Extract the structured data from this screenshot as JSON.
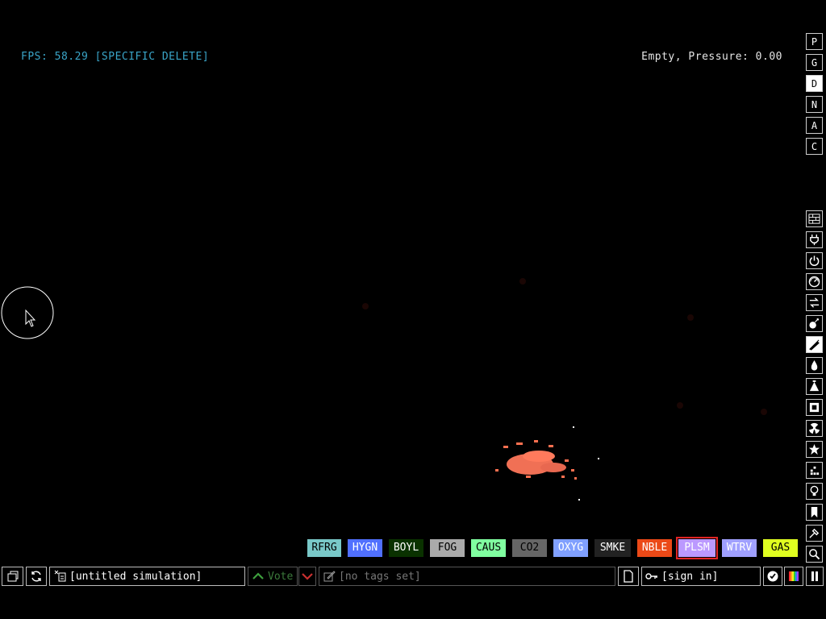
{
  "hud": {
    "fps_text": "FPS: 58.29 [SPECIFIC DELETE]",
    "pressure_text": "Empty, Pressure: 0.00"
  },
  "menu_letters": [
    "P",
    "G",
    "D",
    "N",
    "A",
    "C"
  ],
  "active_menu_letter": "D",
  "category_icons": [
    "walls-icon",
    "electronics-icon",
    "powered-icon",
    "sensors-icon",
    "force-icon",
    "explosives-icon",
    "gases-icon",
    "liquids-icon",
    "powders-icon",
    "solids-icon",
    "radioactive-icon",
    "special-icon",
    "life-icon",
    "tools-icon",
    "favorites-icon",
    "decoration-icon",
    "search-icon"
  ],
  "elements": [
    {
      "label": "RFRG",
      "bg": "#79c8c8",
      "fg": "#000000"
    },
    {
      "label": "HYGN",
      "bg": "#5070ff",
      "fg": "#ffffff"
    },
    {
      "label": "BOYL",
      "bg": "#0a3200",
      "fg": "#ffffff"
    },
    {
      "label": "FOG",
      "bg": "#aaaaaa",
      "fg": "#000000"
    },
    {
      "label": "CAUS",
      "bg": "#80ffa0",
      "fg": "#000000"
    },
    {
      "label": "CO2",
      "bg": "#666666",
      "fg": "#000000"
    },
    {
      "label": "OXYG",
      "bg": "#80a0ff",
      "fg": "#ffffff"
    },
    {
      "label": "SMKE",
      "bg": "#222222",
      "fg": "#ffffff"
    },
    {
      "label": "NBLE",
      "bg": "#eb4917",
      "fg": "#ffffff"
    },
    {
      "label": "PLSM",
      "bg": "#bb99ff",
      "fg": "#ffffff"
    },
    {
      "label": "WTRV",
      "bg": "#a0a0ff",
      "fg": "#ffffff"
    },
    {
      "label": "GAS",
      "bg": "#e0ff20",
      "fg": "#000000"
    }
  ],
  "selected_element": "PLSM",
  "bottom": {
    "save_name": "[untitled simulation]",
    "vote_label": "Vote",
    "tags_text": "[no tags set]",
    "sign_in": "[sign in]"
  },
  "colors": {
    "fps": "#3aa5c8",
    "particles": "#ff7050",
    "selection_outline": "#e02424"
  }
}
